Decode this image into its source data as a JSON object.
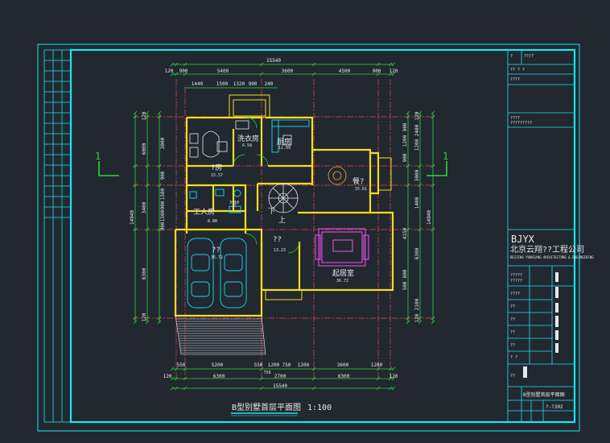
{
  "colors": {
    "background": "#212830",
    "frame": "#19e6f2",
    "wall": "#f2dd1f",
    "dimension": "#2ad63a",
    "axis": "#e84545",
    "furniture": "#d54ad8",
    "text": "#e8e8e8",
    "fixture": "#19d9ec"
  },
  "dimensions": {
    "top_total": "15540",
    "top_segments": [
      "120",
      "900",
      "5400",
      "3600",
      "4500",
      "900",
      "120"
    ],
    "top_sub": [
      "1440",
      "1500",
      "1320",
      "900",
      "240"
    ],
    "bottom_row1": [
      "550",
      "5200",
      "550",
      "1200",
      "750",
      "1200",
      "3600",
      "1200"
    ],
    "bottom_row1b": "750",
    "bottom_row2": [
      "120",
      "6300",
      "2700",
      "6300",
      "120"
    ],
    "bottom_total": "15540",
    "left_outer": "14940",
    "left_segments": [
      "120",
      "6000",
      "3400",
      "6300",
      "120"
    ],
    "left_inner": [
      "3000",
      "900",
      "1500",
      "900",
      "1500",
      "900"
    ],
    "right_outer": "14940",
    "right_segments": [
      "120",
      "2400",
      "1200",
      "3000",
      "1400",
      "4150",
      "6300",
      "2100",
      "120"
    ],
    "right_inner": [
      "900",
      "1200",
      "900",
      "800",
      "500"
    ]
  },
  "rooms": [
    {
      "name": "?房",
      "area": "15.57"
    },
    {
      "name": "洗衣房",
      "area": "6.58"
    },
    {
      "name": "厨房",
      "area": "11.09"
    },
    {
      "name": "餐?",
      "area": "15.61"
    },
    {
      "name": "工人房",
      "area": "8.80"
    },
    {
      "name": "卫",
      "area": "3.10"
    },
    {
      "name": "??",
      "area": "13.23"
    },
    {
      "name": "起居室",
      "area": "36.72"
    },
    {
      "name": "??",
      "area": "35.72"
    }
  ],
  "stair_label": "上",
  "stair_label_down": "下",
  "section_marks": [
    "1",
    "1"
  ],
  "drawing_title": "B型别墅首层平面图",
  "drawing_scale": "1:100",
  "title_block": {
    "company_logo": "BJYX",
    "company_name": "北京云翔??工程公司",
    "company_name_en": "BEIJING YUNXIANG ARCHITECTURE & ENGINEERING",
    "top_codes": [
      "?",
      "??/?",
      "?? ? ?",
      "????"
    ],
    "sub_codes": [
      "????",
      "?????????"
    ],
    "rows": [
      "?????",
      "?????",
      "????",
      "??",
      "??",
      "??",
      "??",
      "? ?",
      "??"
    ],
    "drawing_name": "B型别墅首层平面图",
    "sheet_no": "?-?302"
  },
  "left_strip_rows": 16
}
